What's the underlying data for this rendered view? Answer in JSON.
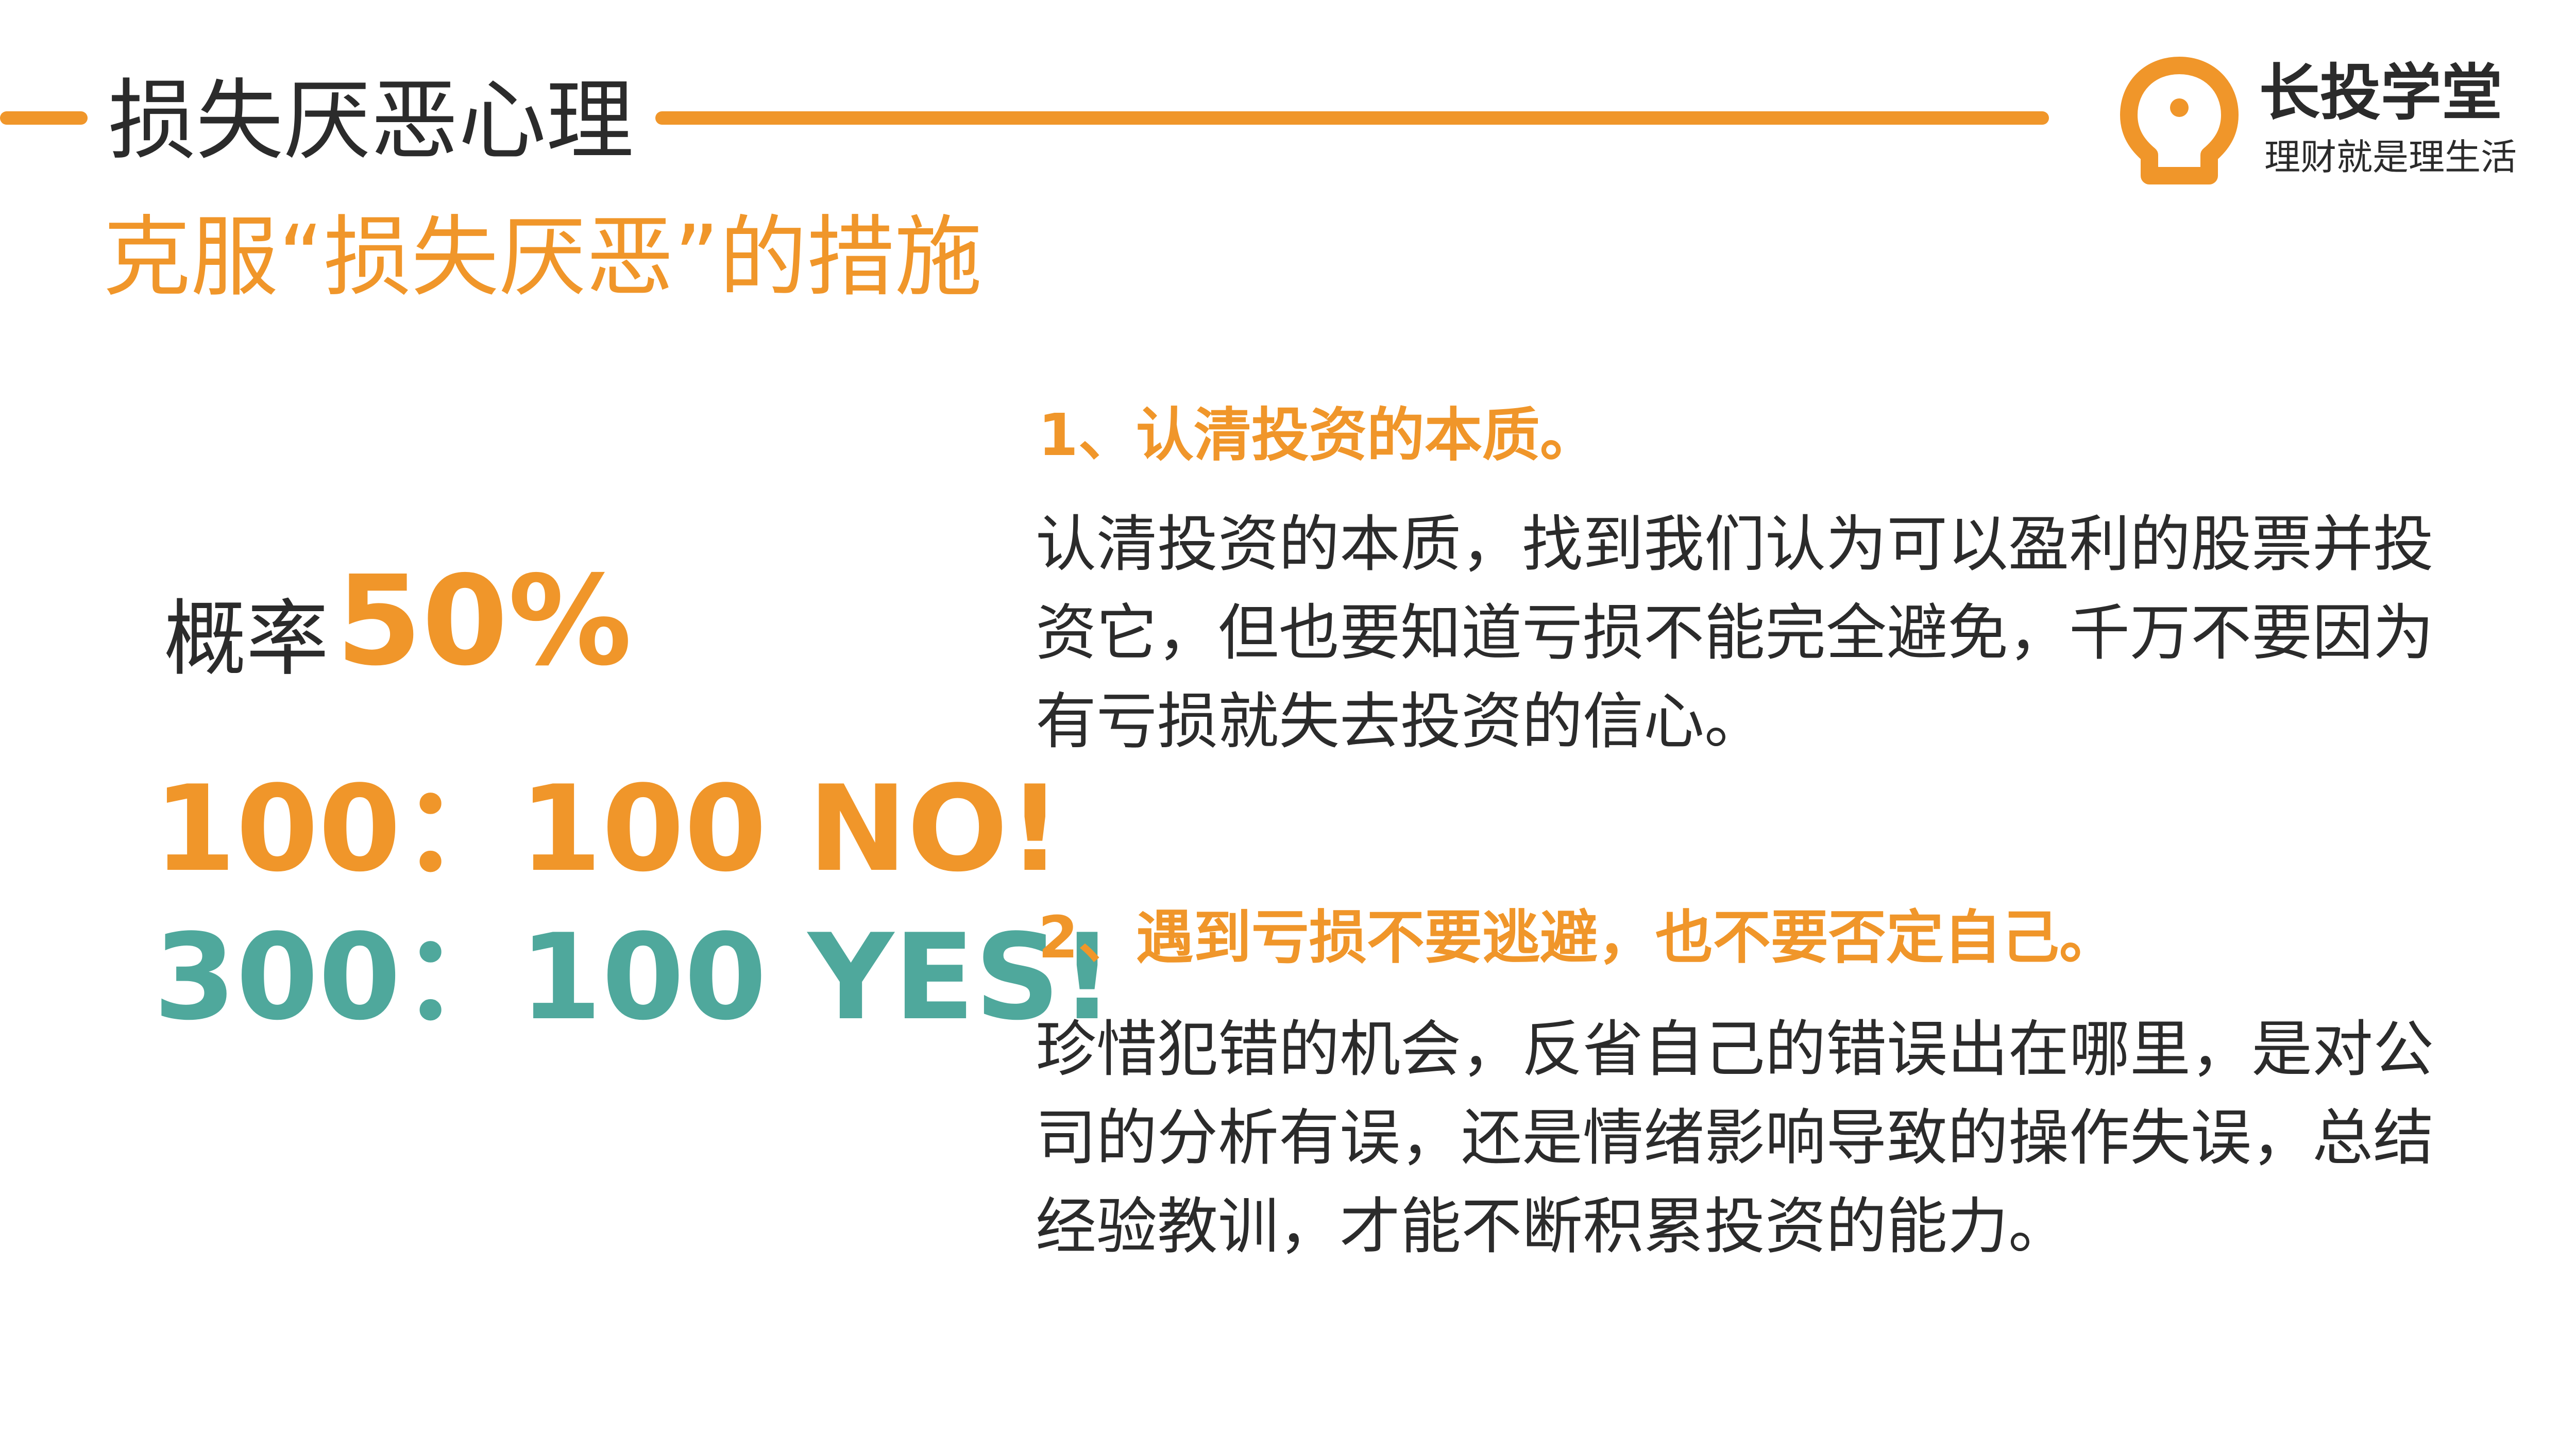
{
  "header": {
    "title": "损失厌恶心理",
    "subtitle": "克服“损失厌恶”的措施"
  },
  "logo": {
    "name": "长投学堂",
    "slogan": "理财就是理生活",
    "icon": "lightbulb-icon",
    "color": "#f0962a"
  },
  "left": {
    "probability_label": "概率",
    "probability_value": "50%",
    "ratio_no": "100：100 NO!",
    "ratio_yes": "300：100 YES!"
  },
  "points": [
    {
      "heading": "1、认清投资的本质。",
      "body": "认清投资的本质，找到我们认为可以盈利的股票并投资它，但也要知道亏损不能完全避免，千万不要因为有亏损就失去投资的信心。"
    },
    {
      "heading": "2、遇到亏损不要逃避，也不要否定自己。",
      "body": "珍惜犯错的机会，反省自己的错误出在哪里，是对公司的分析有误，还是情绪影响导致的操作失误，总结经验教训，才能不断积累投资的能力。"
    }
  ],
  "colors": {
    "accent": "#f0962a",
    "positive": "#4fa89c",
    "text": "#2b2b2b"
  }
}
